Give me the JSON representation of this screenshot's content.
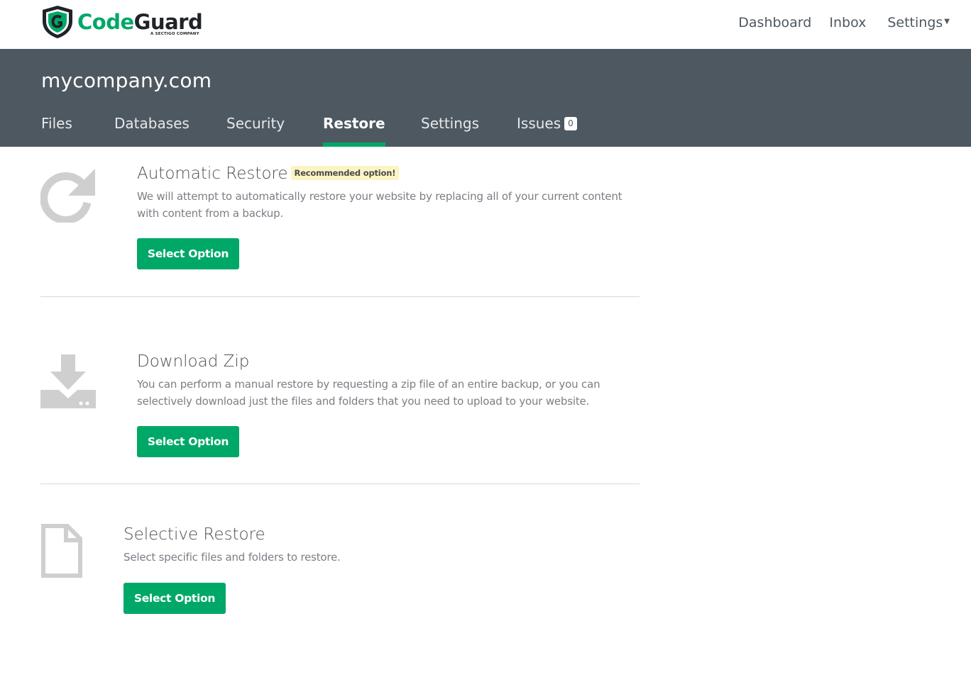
{
  "brand": {
    "name_part1": "Code",
    "name_part2": "Guard",
    "tagline": "A SECTIGO COMPANY",
    "accent_color": "#00a868",
    "header_bg": "#4e5860"
  },
  "topnav": {
    "dashboard": "Dashboard",
    "inbox": "Inbox",
    "settings": "Settings"
  },
  "site": {
    "name": "mycompany.com"
  },
  "tabs": [
    {
      "label": "Files"
    },
    {
      "label": "Databases"
    },
    {
      "label": "Security"
    },
    {
      "label": "Restore",
      "active": true
    },
    {
      "label": "Settings"
    },
    {
      "label": "Issues",
      "badge": "0"
    }
  ],
  "options": [
    {
      "icon": "refresh-icon",
      "title": "Automatic Restore",
      "badge": "Recommended option!",
      "description": "We will attempt to automatically restore your website by replacing all of your current content with content from a backup.",
      "button": "Select Option"
    },
    {
      "icon": "download-icon",
      "title": "Download Zip",
      "description": "You can perform a manual restore by requesting a zip file of an entire backup, or you can selectively download just the files and folders that you need to upload to your website.",
      "button": "Select Option"
    },
    {
      "icon": "file-icon",
      "title": "Selective Restore",
      "description": "Select specific files and folders to restore.",
      "button": "Select Option"
    }
  ]
}
